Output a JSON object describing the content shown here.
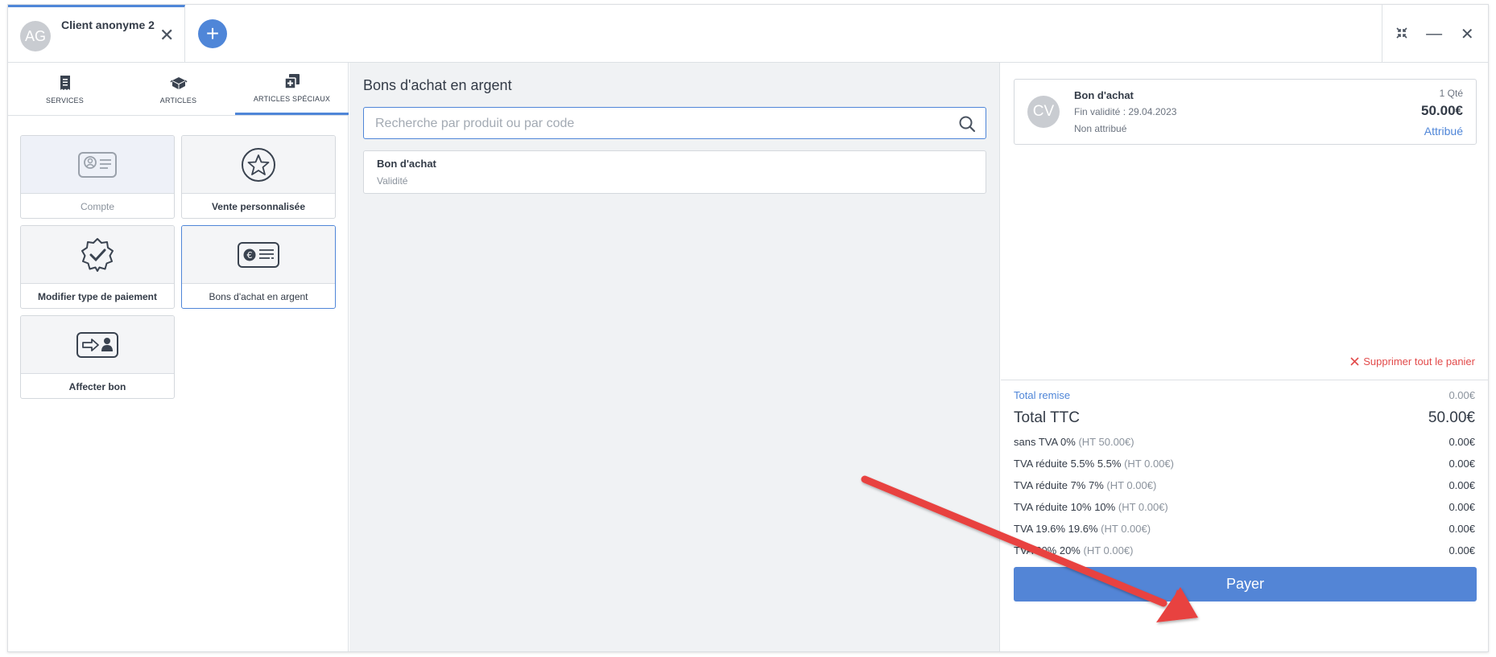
{
  "topbar": {
    "client_initials": "AG",
    "client_name": "Client anonyme 2",
    "close_symbol": "✕",
    "add_symbol": "+",
    "window_controls": {
      "shrink": "⤡",
      "minimize": "—",
      "close": "✕"
    }
  },
  "categories": [
    {
      "label": "SERVICES",
      "icon": "receipt-icon",
      "active": false
    },
    {
      "label": "ARTICLES",
      "icon": "box-icon",
      "active": false
    },
    {
      "label": "ARTICLES SPÉCIAUX",
      "icon": "special-box-icon",
      "active": true
    }
  ],
  "tiles": [
    {
      "label": "Compte",
      "icon": "id-card-icon",
      "disabled": true
    },
    {
      "label": "Vente personnalisée",
      "icon": "star-icon"
    },
    {
      "label": "Modifier type de paiement",
      "icon": "check-badge-icon"
    },
    {
      "label": "Bons d'achat en argent",
      "icon": "euro-voucher-icon",
      "selected": true
    },
    {
      "label": "Affecter bon",
      "icon": "assign-voucher-icon"
    }
  ],
  "middle": {
    "title": "Bons d'achat en argent",
    "search_placeholder": "Recherche par produit ou par code",
    "products": [
      {
        "name": "Bon d'achat",
        "subtitle": "Validité"
      }
    ]
  },
  "cart": {
    "item": {
      "initials": "CV",
      "name": "Bon d'achat",
      "validity": "Fin validité : 29.04.2023",
      "status": "Non attribué",
      "qty": "1 Qté",
      "price": "50.00€",
      "assign_label": "Attribué"
    },
    "clear_label": "Supprimer tout le panier",
    "total_remise_label": "Total remise",
    "total_remise_value": "0.00€",
    "total_ttc_label": "Total TTC",
    "total_ttc_value": "50.00€",
    "taxes": [
      {
        "label": "sans TVA 0%",
        "ht": "(HT 50.00€)",
        "value": "0.00€"
      },
      {
        "label": "TVA réduite 5.5% 5.5%",
        "ht": "(HT 0.00€)",
        "value": "0.00€"
      },
      {
        "label": "TVA réduite 7% 7%",
        "ht": "(HT 0.00€)",
        "value": "0.00€"
      },
      {
        "label": "TVA réduite 10% 10%",
        "ht": "(HT 0.00€)",
        "value": "0.00€"
      },
      {
        "label": "TVA 19.6% 19.6%",
        "ht": "(HT 0.00€)",
        "value": "0.00€"
      },
      {
        "label": "TVA 20% 20%",
        "ht": "(HT 0.00€)",
        "value": "0.00€"
      }
    ],
    "pay_label": "Payer"
  },
  "colors": {
    "accent": "#4f86d8",
    "danger": "#e24b4b",
    "annotation_arrow": "#e8423f"
  }
}
